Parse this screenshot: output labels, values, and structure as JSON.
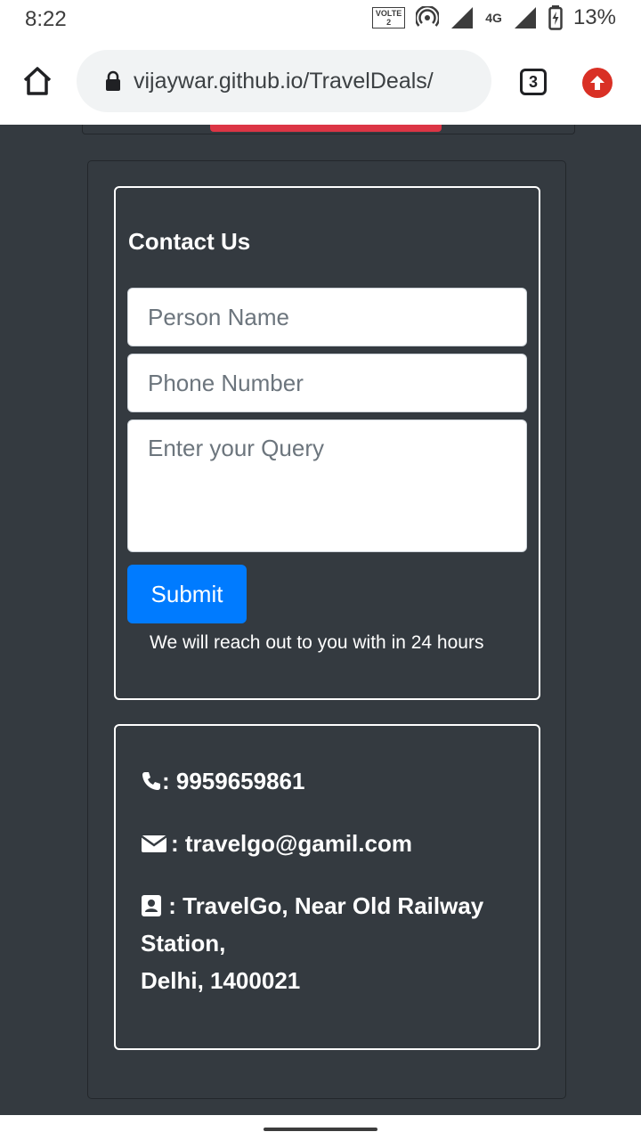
{
  "status": {
    "time": "8:22",
    "volte_top": "VOLTE",
    "volte_sub": "2",
    "network": "4G",
    "battery": "13%"
  },
  "browser": {
    "url": "vijaywar.github.io/TravelDeals/",
    "tab_count": "3"
  },
  "contact": {
    "title": "Contact Us",
    "name_placeholder": "Person Name",
    "phone_placeholder": "Phone Number",
    "query_placeholder": "Enter your Query",
    "submit_label": "Submit",
    "note": "We will reach out to you with in 24 hours"
  },
  "info": {
    "phone": ": 9959659861",
    "email": ": travelgo@gamil.com",
    "address_line1": ": TravelGo, Near Old Railway Station,",
    "address_line2": "Delhi, 1400021"
  },
  "colors": {
    "page_bg": "#343a40",
    "primary": "#007bff",
    "danger": "#dc3545",
    "update_badge": "#d93025"
  }
}
